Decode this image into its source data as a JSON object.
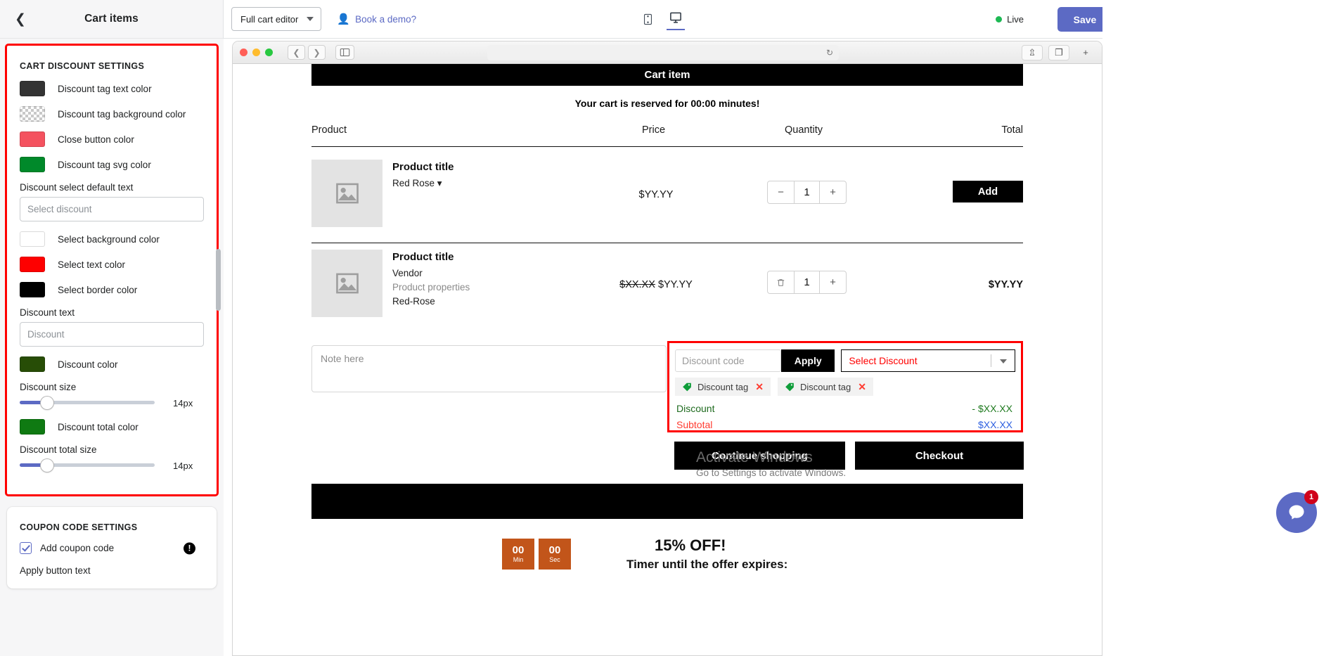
{
  "sidebar": {
    "title": "Cart items",
    "back_icon": "chevron-left-icon",
    "cart_discount": {
      "section_title": "CART DISCOUNT SETTINGS",
      "swatches": [
        {
          "label": "Discount tag text color",
          "color": "#333333",
          "checker": false
        },
        {
          "label": "Discount tag background color",
          "color": "transparent",
          "checker": true
        },
        {
          "label": "Close button color",
          "color": "#f4525f",
          "checker": false
        },
        {
          "label": "Discount tag svg color",
          "color": "#00892a",
          "checker": false
        }
      ],
      "select_default_label": "Discount select default text",
      "select_default_value": "Select discount",
      "swatches2": [
        {
          "label": "Select background color",
          "color": "#ffffff",
          "checker": false
        },
        {
          "label": "Select text color",
          "color": "#fe0000",
          "checker": false
        },
        {
          "label": "Select border color",
          "color": "#000000",
          "checker": false
        }
      ],
      "discount_text_label": "Discount text",
      "discount_text_value": "Discount",
      "discount_color_label": "Discount color",
      "discount_color": "#274d06",
      "discount_size_label": "Discount size",
      "discount_size_value": "14px",
      "discount_total_color_label": "Discount total color",
      "discount_total_color": "#0f7a12",
      "discount_total_size_label": "Discount total size",
      "discount_total_size_value": "14px"
    },
    "coupon": {
      "section_title": "COUPON CODE SETTINGS",
      "add_coupon_label": "Add coupon code",
      "info_icon": "info-icon",
      "apply_button_text_label": "Apply button text"
    }
  },
  "topbar": {
    "editor_select": "Full cart editor",
    "book_demo": "Book a demo?",
    "book_demo_icon": "person-icon",
    "mobile_icon": "mobile-icon",
    "desktop_icon": "desktop-icon",
    "live_label": "Live",
    "live_color": "#1db954",
    "save_label": "Save",
    "save_color": "#5c6ac4"
  },
  "browser": {
    "back_icon": "chevron-left-icon",
    "forward_icon": "chevron-right-icon",
    "sidebar_icon": "sidebar-panel-icon",
    "reload_icon": "reload-icon",
    "share_icon": "share-icon",
    "tabs_icon": "duplicate-tabs-icon",
    "url": ""
  },
  "cart": {
    "banner": "Cart item",
    "reserve_note": "Your cart is reserved for 00:00 minutes!",
    "columns": [
      "Product",
      "Price",
      "Quantity",
      "Total"
    ],
    "items": [
      {
        "title": "Product title",
        "meta": [
          "Red Rose ▾"
        ],
        "meta_gray": [],
        "price_old": "",
        "price": "$YY.YY",
        "qty_minus": "−",
        "qty": "1",
        "qty_plus": "+",
        "action": "Add",
        "total": ""
      },
      {
        "title": "Product title",
        "meta": [
          "Vendor",
          "Red-Rose"
        ],
        "meta_gray": [
          "Product properties"
        ],
        "price_old": "$XX.XX",
        "price": "$YY.YY",
        "qty_minus": "trash-icon",
        "qty": "1",
        "qty_plus": "+",
        "action": "",
        "total": "$YY.YY"
      }
    ],
    "note_placeholder": "Note here",
    "discount": {
      "code_placeholder": "Discount code",
      "apply_label": "Apply",
      "select_value": "Select Discount",
      "select_caret_icon": "chevron-down-icon",
      "tags": [
        {
          "label": "Discount tag",
          "icon": "price-tag-icon",
          "close_icon": "close-icon"
        },
        {
          "label": "Discount tag",
          "icon": "price-tag-icon",
          "close_icon": "close-icon"
        }
      ],
      "summary": [
        {
          "label": "Discount",
          "value": "- $XX.XX",
          "label_color": "#1f6b1f",
          "value_color": "#1f7a1f"
        },
        {
          "label": "Subtotal",
          "value": "$XX.XX",
          "label_color": "#ff3b30",
          "value_color": "#2d5fe0"
        }
      ]
    },
    "continue_label": "Continue shopping",
    "checkout_label": "Checkout",
    "offer": {
      "timer": [
        {
          "num": "00",
          "label": "Min"
        },
        {
          "num": "00",
          "label": "Sec"
        }
      ],
      "title": "15% OFF!",
      "subtitle": "Timer until the offer expires:"
    }
  },
  "watermark": {
    "line1": "Activate Windows",
    "line2": "Go to Settings to activate Windows."
  },
  "chat": {
    "icon": "chat-bubble-icon",
    "badge": "1"
  }
}
